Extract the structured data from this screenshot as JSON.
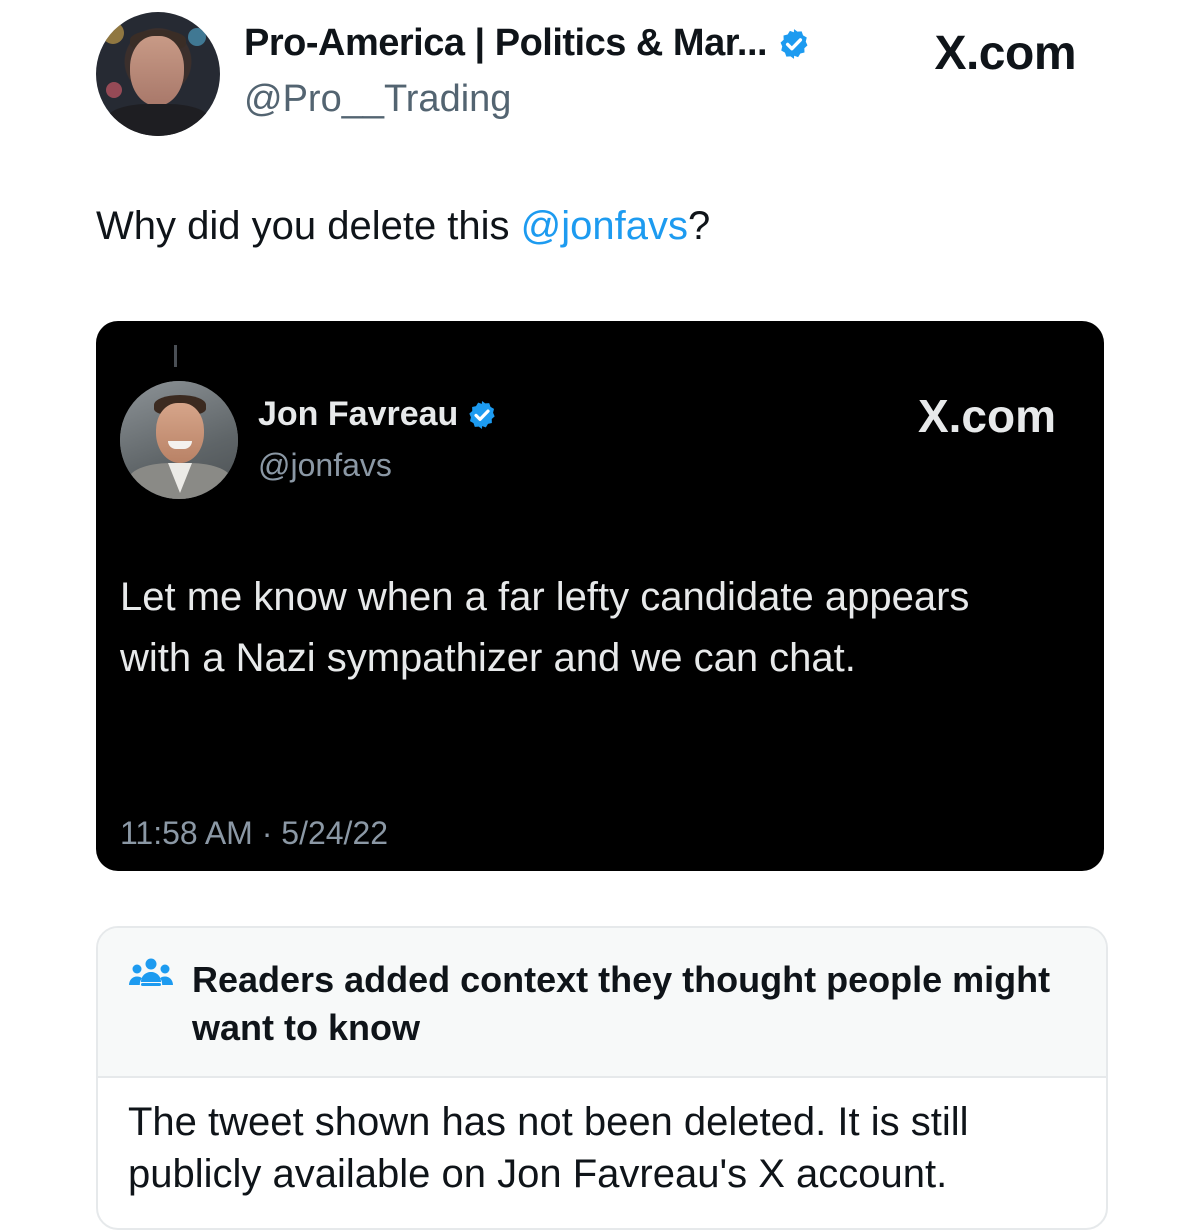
{
  "post": {
    "author": {
      "display_name": "Pro-America | Politics & Mar...",
      "handle": "@Pro__Trading",
      "verified": true
    },
    "brand": "X.com",
    "text_prefix": "Why did you delete this ",
    "mention": "@jonfavs",
    "text_suffix": "?"
  },
  "embedded_tweet": {
    "author": {
      "display_name": "Jon Favreau",
      "handle": "@jonfavs",
      "verified": true
    },
    "brand": "X.com",
    "text": "Let me know when a far lefty candidate appears with a Nazi sympathizer and we can chat.",
    "timestamp": "11:58 AM · 5/24/22"
  },
  "community_note": {
    "icon": "people-icon",
    "title": "Readers added context they thought people might want to know",
    "body": "The tweet shown has not been deleted. It is still publicly available on Jon Favreau's X account."
  },
  "colors": {
    "accent": "#1d9bf0",
    "text": "#0f1419",
    "secondary_text": "#536471",
    "dark_card": "#000000",
    "note_header_bg": "#f7f9f9"
  }
}
